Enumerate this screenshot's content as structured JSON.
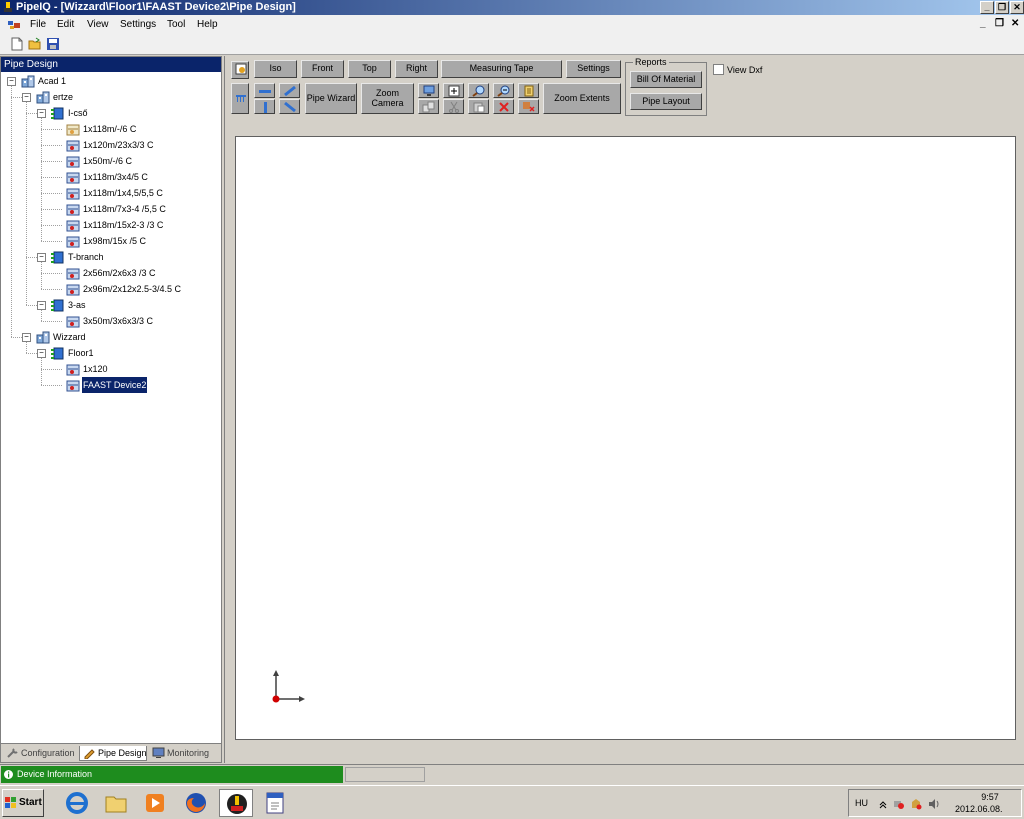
{
  "window": {
    "title": "PipeIQ - [Wizzard\\Floor1\\FAAST Device2\\Pipe Design]",
    "minimize_glyph": "_",
    "restore_glyph": "❐",
    "close_glyph": "✕"
  },
  "menu": {
    "items": [
      "File",
      "Edit",
      "View",
      "Settings",
      "Tool",
      "Help"
    ]
  },
  "mdi_controls": {
    "minimize_glyph": "_",
    "restore_glyph": "❐",
    "close_glyph": "✕"
  },
  "toolbar": {
    "icons": [
      "new-document-icon",
      "open-folder-icon",
      "save-icon"
    ]
  },
  "left_panel": {
    "header": "Pipe Design",
    "tree": [
      {
        "label": "Acad 1",
        "icon": "building-icon",
        "expander": "−"
      },
      {
        "label": "ertze",
        "icon": "building-icon",
        "expander": "−"
      },
      {
        "label": "I-cső",
        "icon": "floor-icon",
        "expander": "−"
      },
      {
        "label": "1x118m/-/6 C",
        "icon": "device-disabled-icon"
      },
      {
        "label": "1x120m/23x3/3 C",
        "icon": "device-icon"
      },
      {
        "label": "1x50m/-/6 C",
        "icon": "device-icon"
      },
      {
        "label": "1x118m/3x4/5 C",
        "icon": "device-icon"
      },
      {
        "label": "1x118m/1x4,5/5,5 C",
        "icon": "device-icon"
      },
      {
        "label": "1x118m/7x3-4 /5,5 C",
        "icon": "device-icon"
      },
      {
        "label": "1x118m/15x2-3  /3 C",
        "icon": "device-icon"
      },
      {
        "label": "1x98m/15x  /5 C",
        "icon": "device-icon"
      },
      {
        "label": "T-branch",
        "icon": "floor-icon",
        "expander": "−"
      },
      {
        "label": "2x56m/2x6x3 /3 C",
        "icon": "device-icon"
      },
      {
        "label": "2x96m/2x12x2.5-3/4.5 C",
        "icon": "device-icon"
      },
      {
        "label": "3-as",
        "icon": "floor-icon",
        "expander": "−"
      },
      {
        "label": "3x50m/3x6x3/3 C",
        "icon": "device-icon"
      },
      {
        "label": "Wizzard",
        "icon": "building-icon",
        "expander": "−"
      },
      {
        "label": "Floor1",
        "icon": "floor-icon",
        "expander": "−"
      },
      {
        "label": "1x120",
        "icon": "device-icon"
      },
      {
        "label": "FAAST Device2",
        "icon": "device-icon"
      }
    ],
    "tabs": [
      "Configuration",
      "Pipe Design",
      "Monitoring"
    ]
  },
  "view_buttons": {
    "iso": "Iso",
    "front": "Front",
    "top": "Top",
    "right": "Right",
    "measuring_tape": "Measuring Tape",
    "settings": "Settings",
    "pipe_wizard": "Pipe Wizard",
    "zoom_camera": "Zoom Camera",
    "zoom_extents": "Zoom Extents"
  },
  "reports": {
    "legend": "Reports",
    "bill_of_material": "Bill Of Material",
    "pipe_layout": "Pipe Layout"
  },
  "view_dxf": {
    "label": "View Dxf",
    "checked": false
  },
  "status": {
    "device_information": "Device Information"
  },
  "taskbar": {
    "start": "Start",
    "language": "HU",
    "time": "9:57",
    "date": "2012.06.08."
  },
  "colors": {
    "selection": "#0a246a",
    "status_green": "#1e8c1e",
    "button_gray": "#a8a8a8"
  }
}
